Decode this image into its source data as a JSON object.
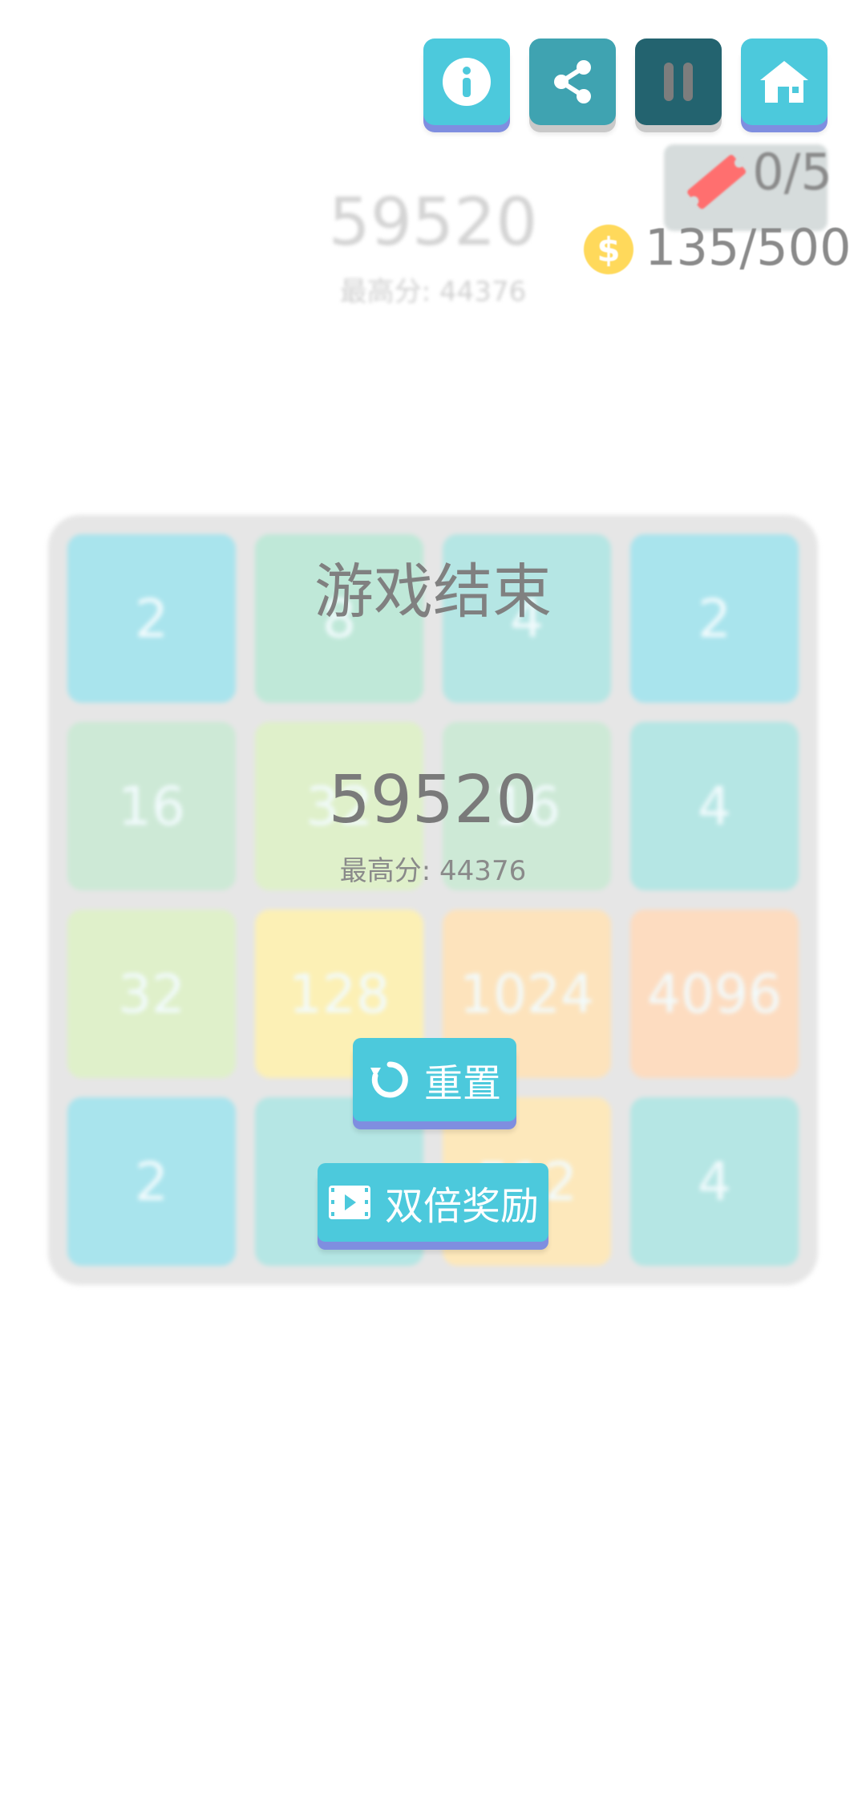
{
  "toolbar": {
    "info": "info-icon",
    "share": "share-icon",
    "pause": "pause-icon",
    "home": "home-icon"
  },
  "resources": {
    "tickets": "0/5",
    "coins": "135/500"
  },
  "background": {
    "score": "59520",
    "best": "最高分:  44376"
  },
  "board": {
    "tiles": [
      [
        "2",
        "8",
        "4",
        "2"
      ],
      [
        "16",
        "32",
        "16",
        "4"
      ],
      [
        "32",
        "128",
        "1024",
        "4096"
      ],
      [
        "2",
        "",
        "512",
        "4"
      ]
    ]
  },
  "game_over": {
    "title": "游戏结束",
    "score": "59520",
    "best": "最高分:  44376",
    "reset_label": "重置",
    "double_label": "双倍奖励"
  },
  "colors": {
    "accent": "#4cc9dc",
    "button_shadow": "#7f8ee0",
    "coin": "#ffd95b",
    "ticket": "#ff6f6f"
  }
}
